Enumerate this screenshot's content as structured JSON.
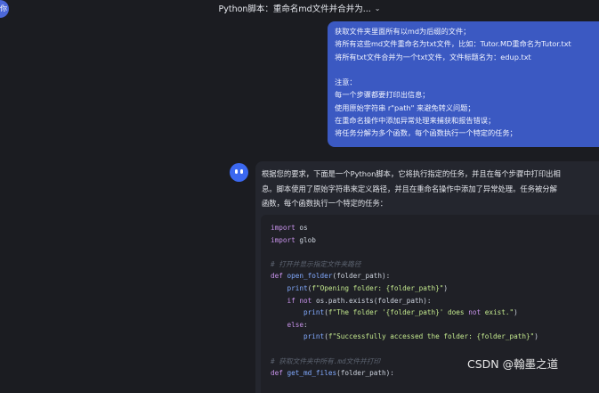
{
  "header": {
    "title": "Python脚本：重命名md文件并合并为...",
    "avatar_text": "你"
  },
  "user_message": {
    "lines": [
      "获取文件夹里面所有以md为后缀的文件；",
      "将所有这些md文件重命名为txt文件，比如：Tutor.MD重命名为Tutor.txt",
      "将所有txt文件合并为一个txt文件，文件标题名为：edup.txt",
      "",
      "注意：",
      "每一个步骤都要打印出信息；",
      "使用原始字符串 r\"path\" 来避免转义问题；",
      "在重命名操作中添加异常处理来捕获和报告错误；",
      "将任务分解为多个函数，每个函数执行一个特定的任务；"
    ]
  },
  "assistant_message": {
    "intro_lines": [
      "根据您的要求，下面是一个Python脚本，它将执行指定的任务，并且在每个步骤中打印出相",
      "息。脚本使用了原始字符串来定义路径，并且在重命名操作中添加了异常处理。任务被分解",
      "函数，每个函数执行一个特定的任务："
    ],
    "code_lines": [
      "import os",
      "import glob",
      "",
      "# 打开并显示指定文件夹路径",
      "def open_folder(folder_path):",
      "    print(f\"Opening folder: {folder_path}\")",
      "    if not os.path.exists(folder_path):",
      "        print(f\"The folder '{folder_path}' does not exist.\")",
      "    else:",
      "        print(f\"Successfully accessed the folder: {folder_path}\")",
      "",
      "# 获取文件夹中所有.md文件并打印",
      "def get_md_files(folder_path):"
    ]
  },
  "watermark": "CSDN @翰墨之道",
  "icons": {
    "title_dropdown": "chevron-down-icon",
    "assistant_avatar": "robot-avatar-icon"
  },
  "colors": {
    "user_bubble": "#3b59c2",
    "background": "#1b1c21",
    "code_bg": "#1f2026"
  }
}
